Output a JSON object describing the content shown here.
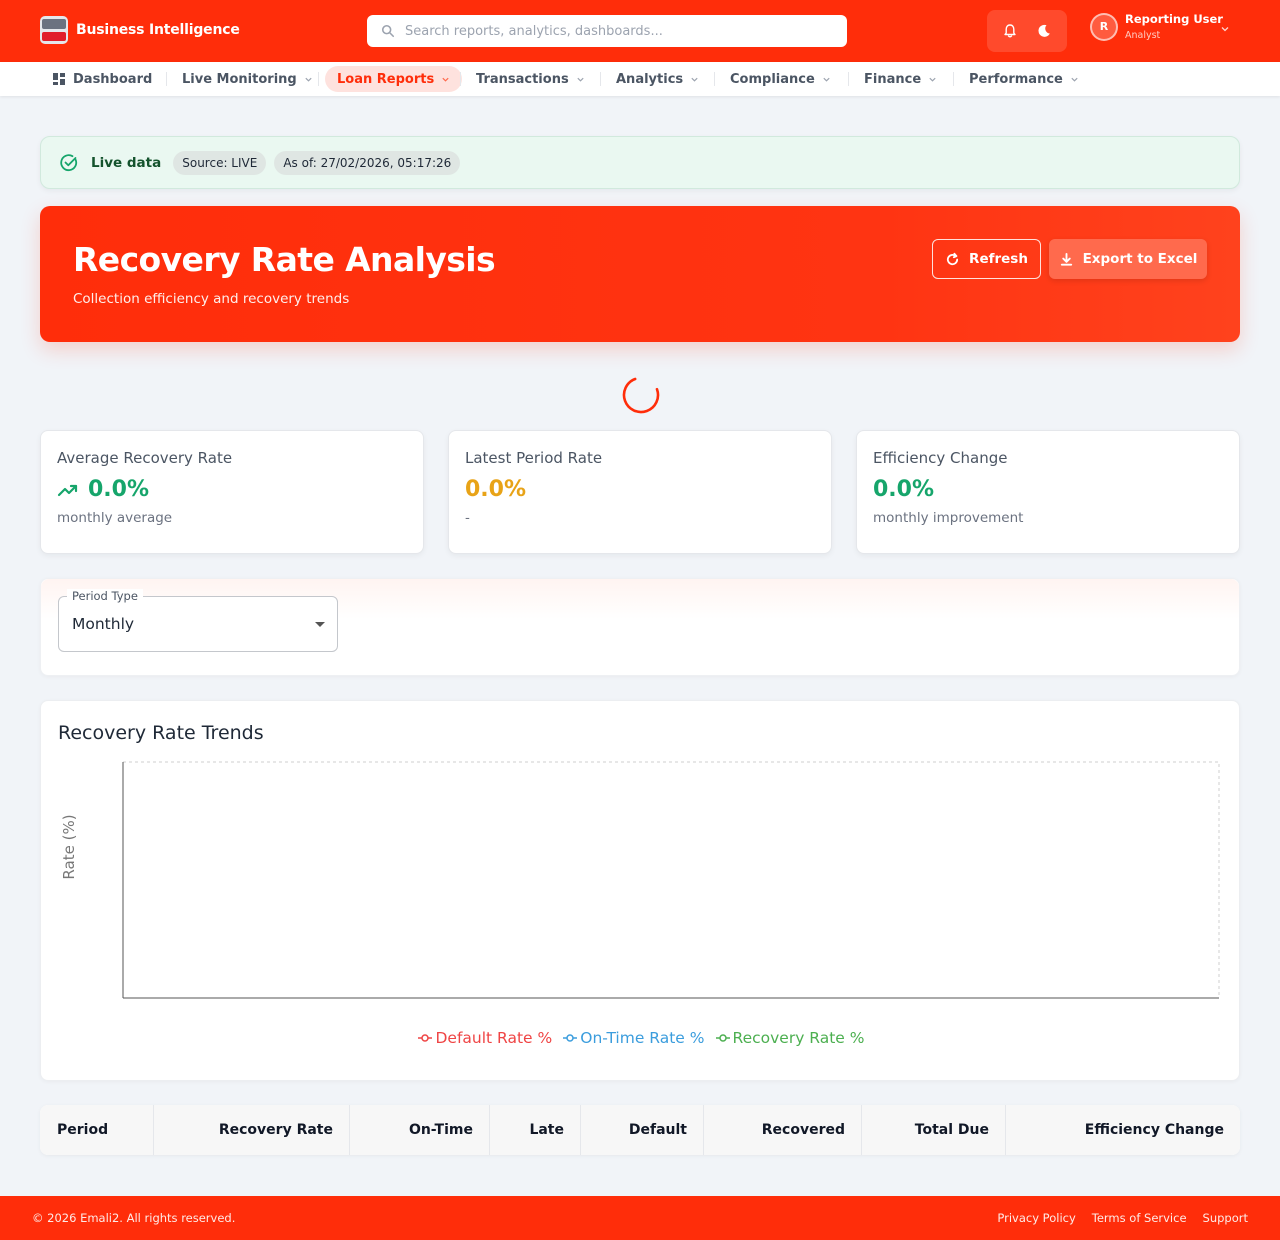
{
  "header": {
    "brand_title": "Business Intelligence",
    "search_placeholder": "Search reports, analytics, dashboards...",
    "user_initial": "R",
    "user_name": "Reporting User",
    "user_role": "Analyst"
  },
  "nav": {
    "items": [
      {
        "label": "Dashboard",
        "has_dropdown": false
      },
      {
        "label": "Live Monitoring",
        "has_dropdown": true
      },
      {
        "label": "Loan Reports",
        "has_dropdown": true,
        "active": true
      },
      {
        "label": "Transactions",
        "has_dropdown": true
      },
      {
        "label": "Analytics",
        "has_dropdown": true
      },
      {
        "label": "Compliance",
        "has_dropdown": true
      },
      {
        "label": "Finance",
        "has_dropdown": true
      },
      {
        "label": "Performance",
        "has_dropdown": true
      }
    ]
  },
  "live_banner": {
    "label": "Live data",
    "source": "Source: LIVE",
    "as_of": "As of: 27/02/2026, 05:17:26"
  },
  "hero": {
    "title": "Recovery Rate Analysis",
    "subtitle": "Collection efficiency and recovery trends",
    "refresh_label": "Refresh",
    "export_label": "Export to Excel"
  },
  "kpis": [
    {
      "label": "Average Recovery Rate",
      "value": "0.0%",
      "sub": "monthly average",
      "icon": "trending-up-icon"
    },
    {
      "label": "Latest Period Rate",
      "value": "0.0%",
      "sub": "-"
    },
    {
      "label": "Efficiency Change",
      "value": "0.0%",
      "sub": "monthly improvement"
    }
  ],
  "filter": {
    "label": "Period Type",
    "value": "Monthly"
  },
  "chart": {
    "title": "Recovery Rate Trends"
  },
  "chart_data": {
    "type": "line",
    "title": "Recovery Rate Trends",
    "xlabel": "",
    "ylabel": "Rate (%)",
    "categories": [],
    "grid": true,
    "legend_position": "bottom",
    "series": [
      {
        "name": "Default Rate %",
        "color": "#ef4444",
        "values": []
      },
      {
        "name": "On-Time Rate %",
        "color": "#3b9ddd",
        "values": []
      },
      {
        "name": "Recovery Rate %",
        "color": "#4caf50",
        "values": []
      }
    ]
  },
  "table": {
    "columns": [
      "Period",
      "Recovery Rate",
      "On-Time",
      "Late",
      "Default",
      "Recovered",
      "Total Due",
      "Efficiency Change"
    ],
    "rows": []
  },
  "footer": {
    "copyright": "© 2026 Emali2. All rights reserved.",
    "links": [
      "Privacy Policy",
      "Terms of Service",
      "Support"
    ]
  },
  "colors": {
    "brand": "#ff2d0a",
    "success": "#16a56b",
    "warning": "#e8a317"
  }
}
